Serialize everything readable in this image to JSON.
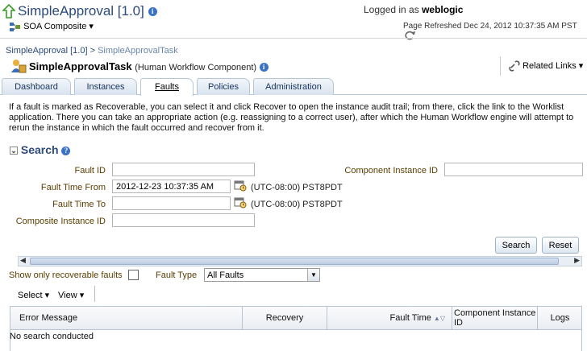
{
  "header": {
    "app_title": "SimpleApproval [1.0]",
    "logged_in_label": "Logged in as",
    "username": "weblogic",
    "page_refreshed": "Page Refreshed Dec 24, 2012 10:37:35 AM PST",
    "composite_menu": "SOA Composite"
  },
  "breadcrumb": {
    "parent": "SimpleApproval [1.0]",
    "separator": ">",
    "current": "SimpleApprovalTask"
  },
  "task": {
    "name": "SimpleApprovalTask",
    "type": "(Human Workflow Component)",
    "related_links": "Related Links"
  },
  "tabs": [
    {
      "label": "Dashboard"
    },
    {
      "label": "Instances"
    },
    {
      "label": "Faults"
    },
    {
      "label": "Policies"
    },
    {
      "label": "Administration"
    }
  ],
  "description": "If a fault is marked as Recoverable, you can select it and click Recover to open the instance audit trail; from there, click the link to the Worklist application. There you can take an appropriate action (e.g. reassigning to a correct user), after which the Human Workflow engine will attempt to rerun the instance in which the fault occurred and recover from it.",
  "search": {
    "heading": "Search",
    "fault_id_label": "Fault ID",
    "fault_id_value": "",
    "component_instance_id_label": "Component Instance ID",
    "component_instance_id_value": "",
    "fault_time_from_label": "Fault Time From",
    "fault_time_from_value": "2012-12-23 10:37:35 AM",
    "fault_time_to_label": "Fault Time To",
    "fault_time_to_value": "",
    "timezone": "(UTC-08:00) PST8PDT",
    "composite_instance_id_label": "Composite Instance ID",
    "composite_instance_id_value": "",
    "search_button": "Search",
    "reset_button": "Reset"
  },
  "filters": {
    "recoverable_label": "Show only recoverable faults",
    "fault_type_label": "Fault Type",
    "fault_type_value": "All Faults"
  },
  "toolbar": {
    "select_label": "Select",
    "view_label": "View"
  },
  "table": {
    "columns": [
      "Error Message",
      "Recovery",
      "Fault Time",
      "Component Instance ID",
      "Logs"
    ],
    "empty_message": "No search conducted"
  },
  "colors": {
    "title_blue": "#2c4a7a",
    "label_brown": "#5a3e00",
    "tab_border": "#b4c6da"
  }
}
